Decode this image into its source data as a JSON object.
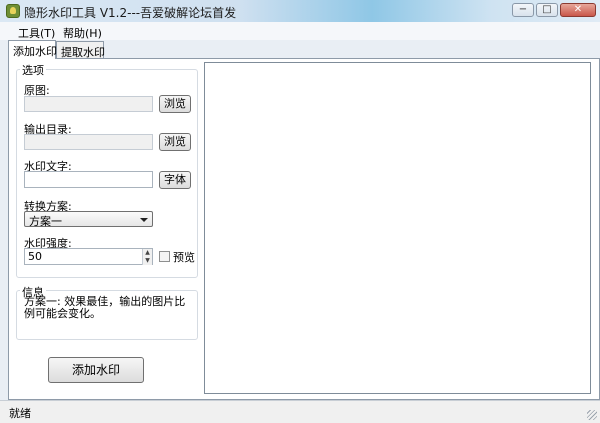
{
  "window": {
    "title": "隐形水印工具 V1.2---吾爱破解论坛首发",
    "min_symbol": "−",
    "max_symbol": "□",
    "close_symbol": "✕"
  },
  "menu": {
    "tools": "工具(T)",
    "help": "帮助(H)"
  },
  "tabs": {
    "add": "添加水印",
    "extract": "提取水印"
  },
  "options": {
    "caption": "选项",
    "source_label": "原图:",
    "source_value": "",
    "browse_source": "浏览",
    "output_label": "输出目录:",
    "output_value": "",
    "browse_output": "浏览",
    "watermark_text_label": "水印文字:",
    "watermark_text_value": "",
    "font_button": "字体",
    "scheme_label": "转换方案:",
    "scheme_selected": "方案一",
    "strength_label": "水印强度:",
    "strength_value": "50",
    "preview_label": "预览",
    "preview_checked": false
  },
  "info": {
    "caption": "信息",
    "text": "方案一: 效果最佳，输出的图片比例可能会变化。"
  },
  "add_button": "添加水印",
  "status": "就绪"
}
